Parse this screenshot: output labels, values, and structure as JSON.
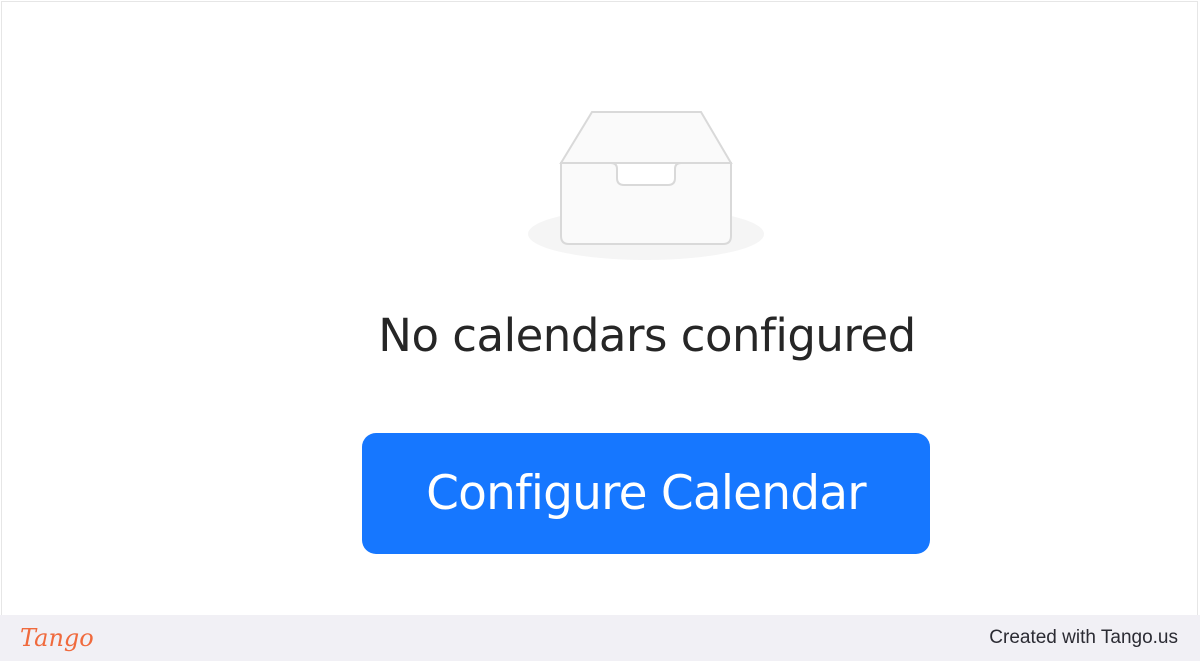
{
  "empty_state": {
    "icon": "inbox-tray-icon",
    "message": "No calendars configured",
    "button_label": "Configure Calendar"
  },
  "colors": {
    "primary": "#1677ff",
    "footer_background": "#f1f0f5",
    "tango_brand": "#f06a3d"
  },
  "footer": {
    "logo_text": "Tango",
    "credit_text": "Created with Tango.us"
  }
}
